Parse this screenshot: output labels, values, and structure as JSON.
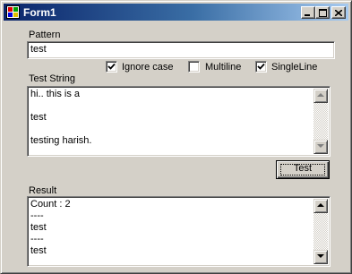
{
  "window": {
    "title": "Form1"
  },
  "pattern": {
    "label": "Pattern",
    "value": "test"
  },
  "options": {
    "ignore_case": {
      "label": "Ignore case",
      "checked": true
    },
    "multiline": {
      "label": "Multiline",
      "checked": false
    },
    "singleline": {
      "label": "SingleLine",
      "checked": true
    }
  },
  "test_string": {
    "label": "Test String",
    "lines": [
      "hi.. this is a",
      "",
      "test",
      "",
      "testing harish."
    ]
  },
  "test_button": {
    "label": "Test"
  },
  "result": {
    "label": "Result",
    "lines": [
      "Count : 2",
      "----",
      "test",
      "----",
      "test"
    ]
  }
}
